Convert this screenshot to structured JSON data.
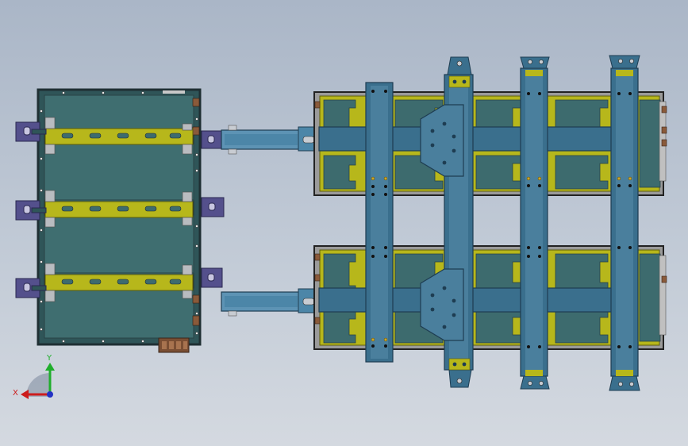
{
  "viewport": {
    "background_top": "#aab6c7",
    "background_bottom": "#d4d9e0"
  },
  "colors": {
    "panel": "#3d6b6e",
    "panel_dark": "#2f5558",
    "frame": "#1f2f33",
    "rail_yellow": "#b7b71b",
    "rail_yellow_dark": "#8a8a10",
    "beam_blue": "#3a6f8d",
    "beam_dark": "#1e3d52",
    "bracket_purple": "#54508c",
    "connector_brown": "#8a5a3a",
    "bolt_gold": "#c9a62a",
    "axis_x": "#cc1c1c",
    "axis_y": "#1fae2c",
    "axis_z": "#2231c4"
  },
  "triad": {
    "x_label": "X",
    "y_label": "Y"
  }
}
